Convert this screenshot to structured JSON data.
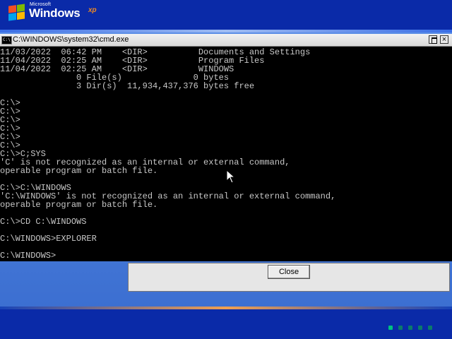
{
  "logo": {
    "microsoft": "Microsoft",
    "windows": "Windows",
    "xp": "xp",
    "flag_colors": [
      "#f25022",
      "#7fba00",
      "#00a4ef",
      "#ffb900"
    ]
  },
  "console": {
    "title": "C:\\WINDOWS\\system32\\cmd.exe",
    "icon": "C:\\",
    "close_glyph": "×",
    "lines": [
      "11/03/2022  06:42 PM    <DIR>          Documents and Settings",
      "11/04/2022  02:25 AM    <DIR>          Program Files",
      "11/04/2022  02:25 AM    <DIR>          WINDOWS",
      "               0 File(s)              0 bytes",
      "               3 Dir(s)  11,934,437,376 bytes free",
      "",
      "C:\\>",
      "C:\\>",
      "C:\\>",
      "C:\\>",
      "C:\\>",
      "C:\\>",
      "C:\\>C;SYS",
      "'C' is not recognized as an internal or external command,",
      "operable program or batch file.",
      "",
      "C:\\>C:\\WINDOWS",
      "'C:\\WINDOWS' is not recognized as an internal or external command,",
      "operable program or batch file.",
      "",
      "C:\\>CD C:\\WINDOWS",
      "",
      "C:\\WINDOWS>EXPLORER",
      "",
      "C:\\WINDOWS>"
    ]
  },
  "dialog": {
    "close_label": "Close"
  },
  "progress": {
    "active_block": 1,
    "total_blocks": 5,
    "active_color": "#00c080",
    "inactive_color": "#0a7a6a"
  }
}
